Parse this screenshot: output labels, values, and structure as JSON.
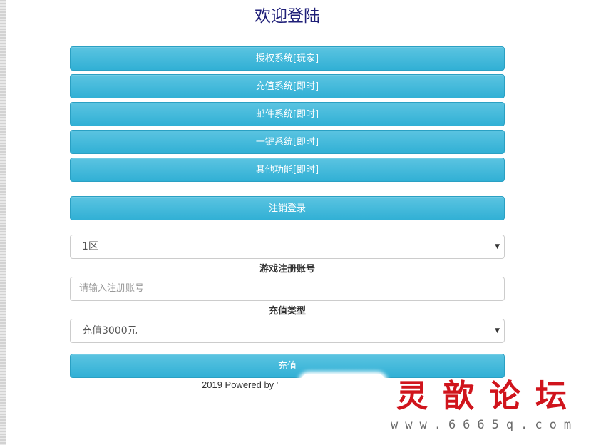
{
  "page": {
    "title": "欢迎登陆"
  },
  "menu": {
    "items": [
      {
        "label": "授权系统[玩家]"
      },
      {
        "label": "充值系统[即时]"
      },
      {
        "label": "邮件系统[即时]"
      },
      {
        "label": "一键系统[即时]"
      },
      {
        "label": "其他功能[即时]"
      }
    ],
    "logout_label": "注销登录"
  },
  "form": {
    "server_select": {
      "value": "1区"
    },
    "account_label": "游戏注册账号",
    "account_input": {
      "placeholder": "请输入注册账号"
    },
    "recharge_type_label": "充值类型",
    "recharge_select": {
      "value": "充值3000元"
    },
    "submit_label": "充值"
  },
  "footer": {
    "text": "2019 Powered by '"
  },
  "watermark": {
    "title": "灵歆论坛",
    "url": "www.6665q.com"
  },
  "colors": {
    "button": "#31b0d5",
    "title": "#1f1f78",
    "watermark_red": "#d0141c"
  }
}
